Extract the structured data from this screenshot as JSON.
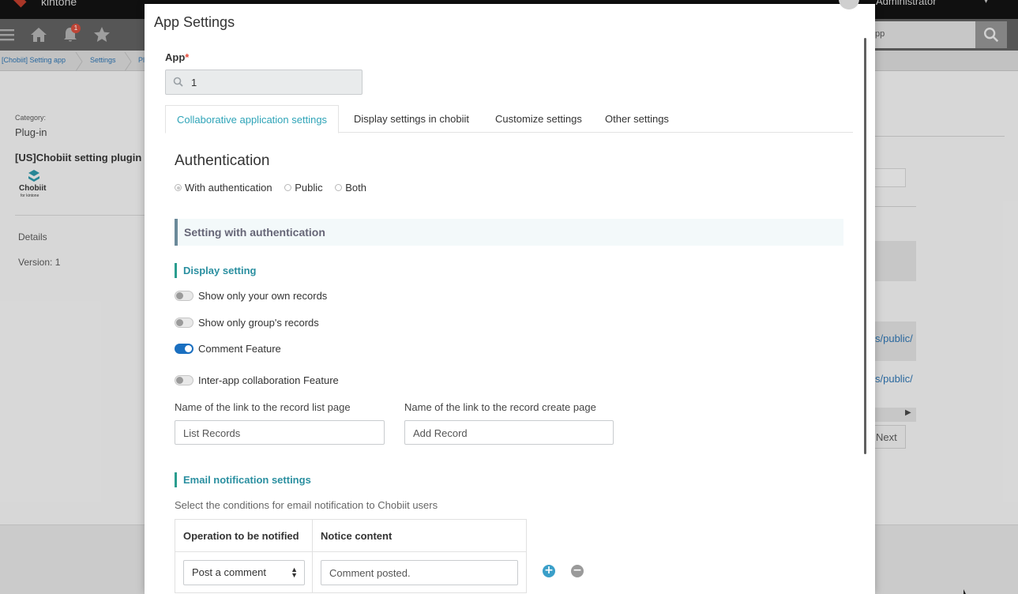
{
  "background": {
    "logo_text": "kintone",
    "admin_label": "Administrator",
    "notification_count": "1",
    "search_value": "pp",
    "breadcrumbs": [
      "[Chobiit] Setting app",
      "Settings",
      "Pl"
    ],
    "category_label": "Category:",
    "category_value": "Plug-in",
    "plugin_name": "[US]Chobiit setting plugin",
    "plugin_logo_text": "Chobiit",
    "plugin_logo_subtext": "for kintone",
    "details_label": "Details",
    "version_label": "Version: 1",
    "right_link_1": "s/public/",
    "right_link_2": "s/public/",
    "next_label": "Next"
  },
  "modal": {
    "title": "App Settings",
    "app_field": {
      "label": "App",
      "required_mark": "*",
      "value": "1"
    },
    "tabs": [
      {
        "label": "Collaborative application settings",
        "active": true
      },
      {
        "label": "Display settings in chobiit",
        "active": false
      },
      {
        "label": "Customize settings",
        "active": false
      },
      {
        "label": "Other settings",
        "active": false
      }
    ],
    "authentication": {
      "title": "Authentication",
      "options": [
        {
          "label": "With authentication",
          "checked": true
        },
        {
          "label": "Public",
          "checked": false
        },
        {
          "label": "Both",
          "checked": false
        }
      ]
    },
    "panel_header": "Setting with authentication",
    "display_setting": {
      "title": "Display setting",
      "toggles": [
        {
          "label": "Show only your own records",
          "on": false
        },
        {
          "label": "Show only group's records",
          "on": false
        },
        {
          "label": "Comment Feature",
          "on": true
        },
        {
          "label": "Inter-app collaboration Feature",
          "on": false
        }
      ],
      "list_link": {
        "label": "Name of the link to the record list page",
        "value": "List Records"
      },
      "create_link": {
        "label": "Name of the link to the record create page",
        "value": "Add Record"
      }
    },
    "email": {
      "title": "Email notification settings",
      "hint": "Select the conditions for email notification to Chobiit users",
      "headers": [
        "Operation to be notified",
        "Notice content"
      ],
      "row": {
        "operation": "Post a comment",
        "content": "Comment posted."
      }
    }
  },
  "colors": {
    "accent": "#2fa4b8",
    "toggle_on": "#1a6fc0",
    "section_bar": "#2a9d8f",
    "add_button": "#3a9fc9"
  }
}
